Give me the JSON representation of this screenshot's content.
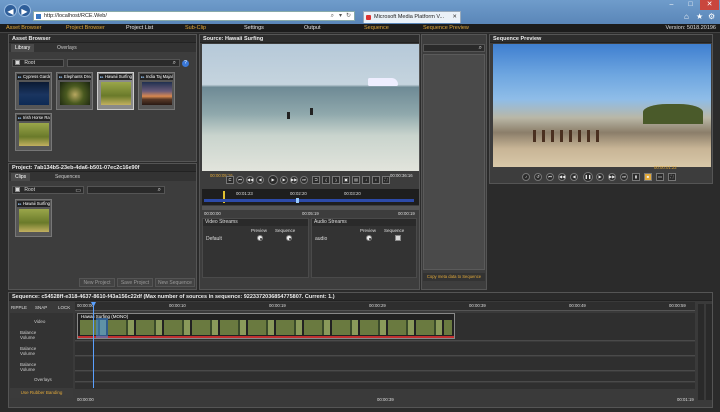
{
  "browser": {
    "url": "http://localhost/RCE.Web/",
    "tab_title": "Microsoft Media Platform V...",
    "back_icon": "back-arrow-icon",
    "forward_icon": "forward-arrow-icon"
  },
  "menu": {
    "items": [
      "Asset Browser",
      "Project Browser",
      "Project List",
      "Sub-Clip",
      "Settings",
      "Output",
      "Sequence",
      "Sequence Preview"
    ],
    "version": "Version: 5018.20196"
  },
  "asset_browser": {
    "title": "Asset Browser",
    "tabs": [
      "Library",
      "Overlays"
    ],
    "root_label": "Root",
    "thumbnails": [
      "Cypress Garden",
      "Elephants Drea",
      "Hawaii Surfing",
      "India Taj Majal",
      "Irish Horse Ra"
    ]
  },
  "project": {
    "title": "Project: 7ab134b5-23eb-4da6-b501-07ec2c16e90f",
    "tabs": [
      "Clips",
      "Sequences"
    ],
    "root_label": "Root",
    "clip": "Hawaii Surfing",
    "buttons": [
      "New Project",
      "Save Project",
      "New Sequence"
    ]
  },
  "source": {
    "title": "Source: Hawaii Surfing",
    "time_in": "00:00:05:16",
    "time_out": "00:00:36:16",
    "scrub_times": [
      "00:01:23",
      "00:02:20",
      "00:03:20"
    ],
    "start": "00:00:00",
    "mid": "00:05:19",
    "end": "00:00:19",
    "video_streams_label": "Video Streams",
    "audio_streams_label": "Audio Streams",
    "preview_label": "Preview",
    "sequence_label": "Sequence",
    "default_label": "Default",
    "audio_label": "audio"
  },
  "metadata": {
    "copy_button": "Copy meta data to Sequence"
  },
  "sequence_preview": {
    "title": "Sequence Preview",
    "time": "00:00:01:22"
  },
  "sequence": {
    "title": "Sequence: c54528ff-e318-4637-8610-f43a156c22df (Max number of sources in sequence: 9223372036854775807. Current: 1.)",
    "tools": [
      "RIPPLE",
      "SNAP",
      "LOCK"
    ],
    "ruler": [
      "00:00:00",
      "00:00:10",
      "00:00:19",
      "00:00:29",
      "00:00:39",
      "00:00:49",
      "00:00:59"
    ],
    "track_video": "Video",
    "balance_label": "Balance",
    "volume_label": "Volume",
    "track_overlays": "Overlays",
    "clip_title": "Hawaii Surfing (MONO)",
    "bottom_times": [
      "00:00:00",
      "00:00:39",
      "00:01:19"
    ],
    "rubber_banding": "Use Rubber Banding"
  },
  "colors": {
    "accent": "#e0a83a",
    "chrome": "#5a86b8",
    "panel": "#3d3d3d"
  }
}
